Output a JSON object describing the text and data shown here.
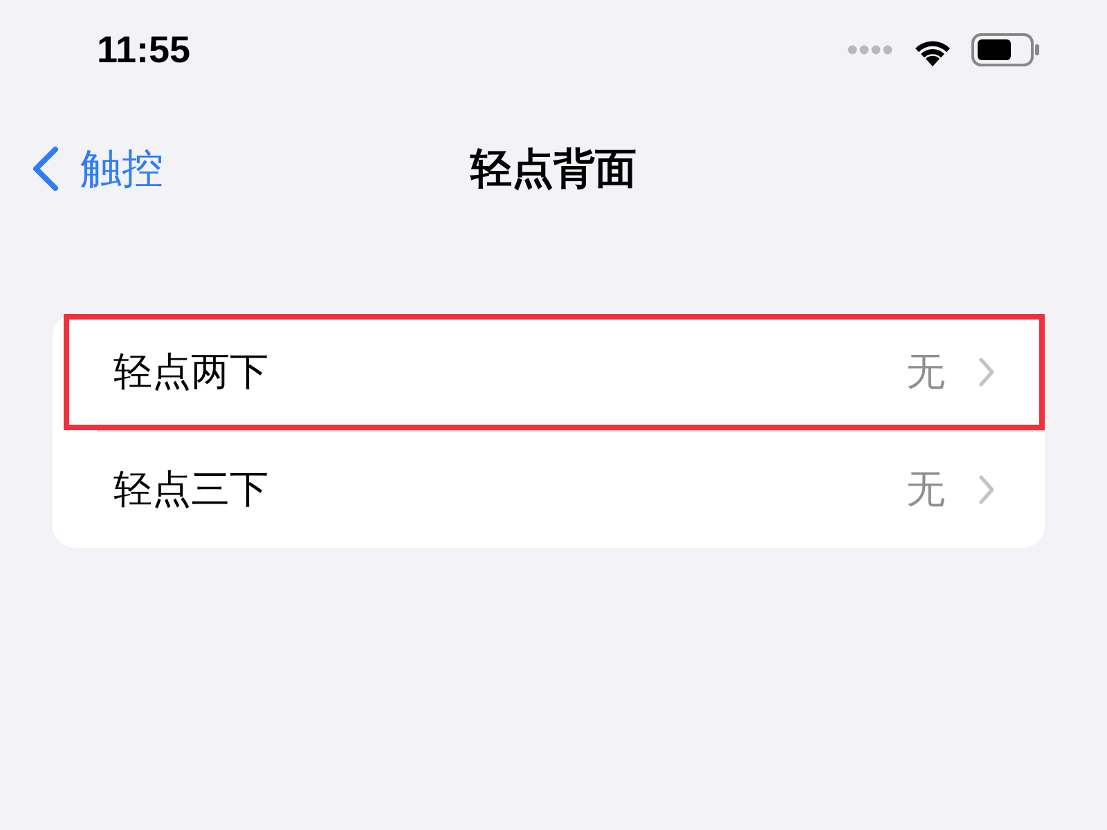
{
  "status_bar": {
    "time": "11:55"
  },
  "nav": {
    "back": "触控",
    "title": "轻点背面"
  },
  "rows": [
    {
      "label": "轻点两下",
      "value": "无",
      "highlighted": true
    },
    {
      "label": "轻点三下",
      "value": "无",
      "highlighted": false
    }
  ]
}
